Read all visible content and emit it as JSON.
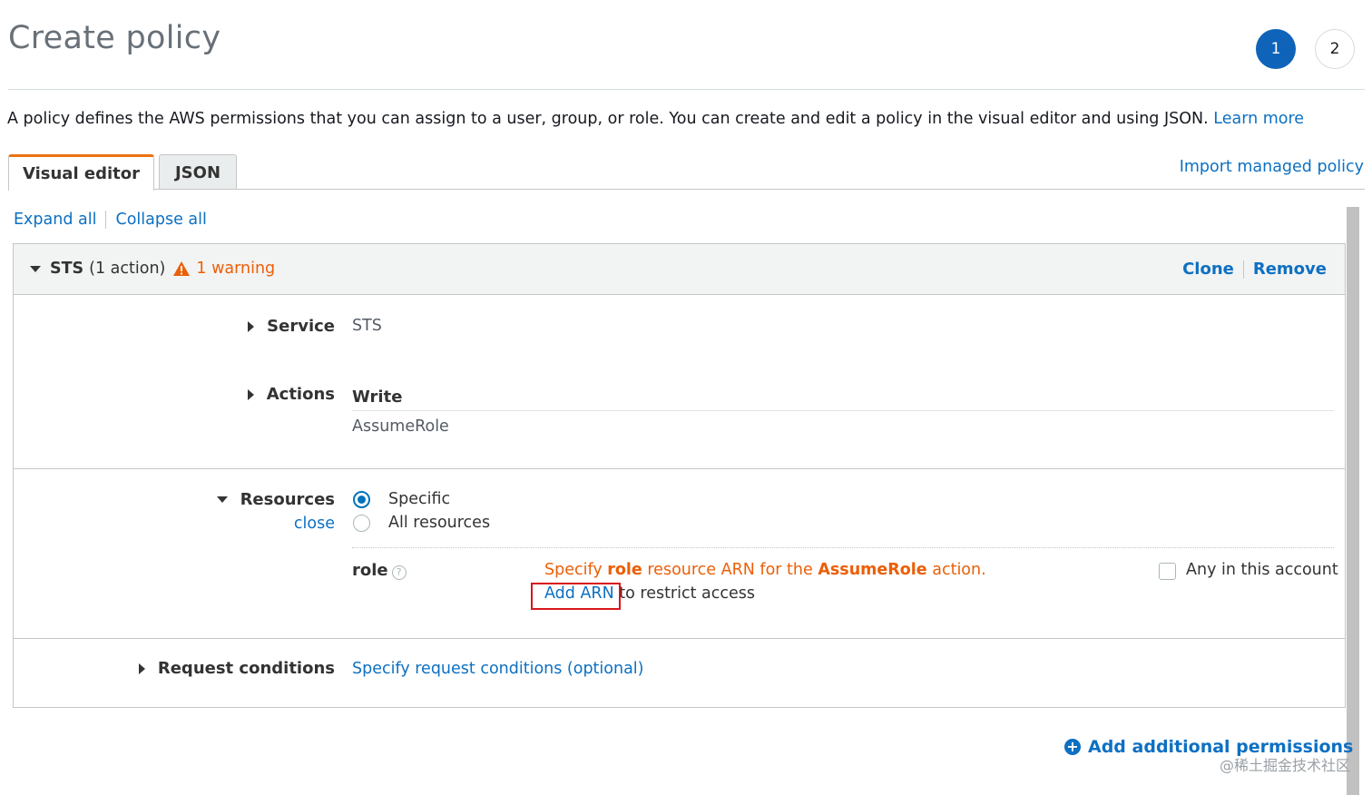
{
  "header": {
    "title": "Create policy",
    "steps": [
      "1",
      "2"
    ]
  },
  "intro": {
    "text": "A policy defines the AWS permissions that you can assign to a user, group, or role. You can create and edit a policy in the visual editor and using JSON.",
    "learn_more": "Learn more"
  },
  "tabs": {
    "visual": "Visual editor",
    "json": "JSON",
    "import_link": "Import managed policy"
  },
  "controls": {
    "expand_all": "Expand all",
    "collapse_all": "Collapse all"
  },
  "panel": {
    "service_name": "STS",
    "action_count": "(1 action)",
    "warning": "1 warning",
    "clone": "Clone",
    "remove": "Remove",
    "service_label": "Service",
    "service_value": "STS",
    "actions_label": "Actions",
    "actions_group": "Write",
    "actions_value": "AssumeRole",
    "resources_label": "Resources",
    "resources_close": "close",
    "radio_specific": "Specific",
    "radio_all": "All resources",
    "role_label": "role",
    "help_glyph": "?",
    "role_msg_part1": "Specify",
    "role_msg_bold1": "role",
    "role_msg_part2": "resource ARN for the",
    "role_msg_bold2": "AssumeRole",
    "role_msg_part3": "action.",
    "add_arn": "Add ARN",
    "restrict": "to restrict access",
    "any_account": "Any in this account",
    "request_label": "Request conditions",
    "request_value": "Specify request conditions (optional)"
  },
  "footer": {
    "add_permissions": "Add additional permissions",
    "plus_glyph": "+",
    "watermark": "@稀土掘金技术社区"
  }
}
